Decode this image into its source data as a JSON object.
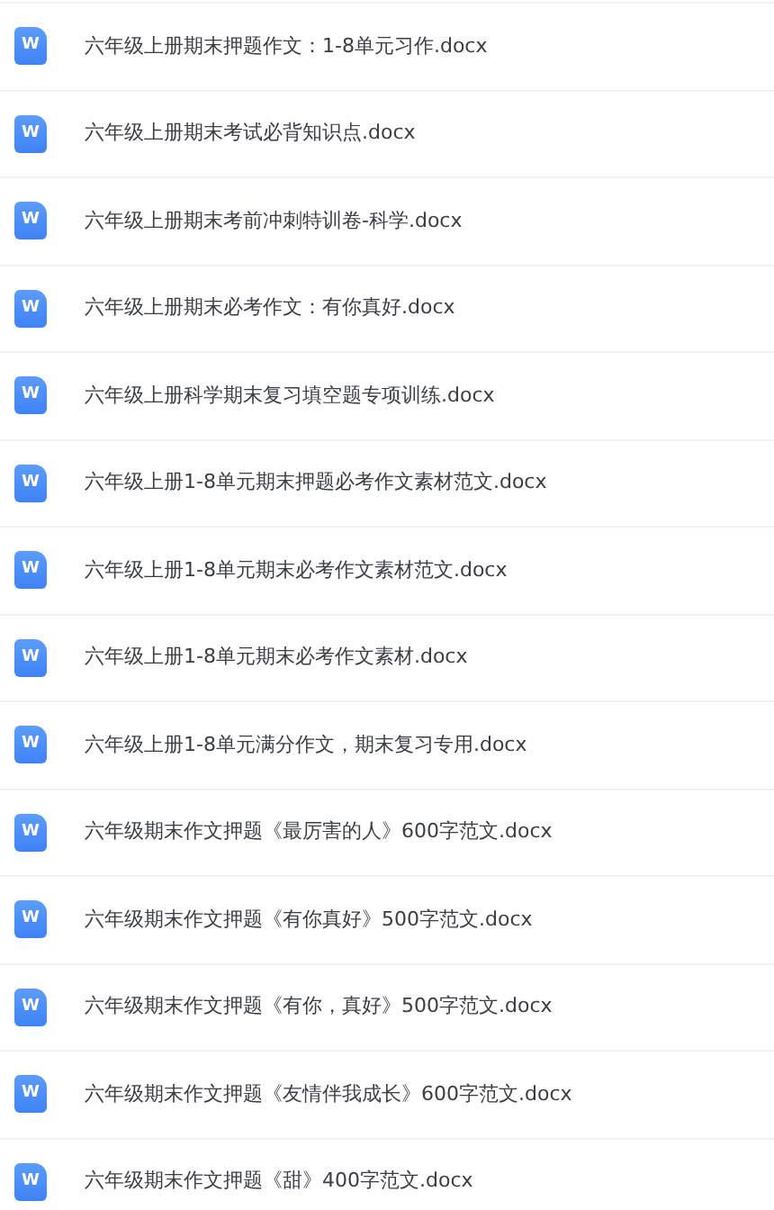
{
  "files": [
    {
      "icon_label": "W",
      "name": "六年级上册期末押题作文：1-8单元习作.docx"
    },
    {
      "icon_label": "W",
      "name": "六年级上册期末考试必背知识点.docx"
    },
    {
      "icon_label": "W",
      "name": "六年级上册期末考前冲刺特训卷-科学.docx"
    },
    {
      "icon_label": "W",
      "name": "六年级上册期末必考作文：有你真好.docx"
    },
    {
      "icon_label": "W",
      "name": "六年级上册科学期末复习填空题专项训练.docx"
    },
    {
      "icon_label": "W",
      "name": "六年级上册1-8单元期末押题必考作文素材范文.docx"
    },
    {
      "icon_label": "W",
      "name": "六年级上册1-8单元期末必考作文素材范文.docx"
    },
    {
      "icon_label": "W",
      "name": "六年级上册1-8单元期末必考作文素材.docx"
    },
    {
      "icon_label": "W",
      "name": "六年级上册1-8单元满分作文，期末复习专用.docx"
    },
    {
      "icon_label": "W",
      "name": "六年级期末作文押题《最厉害的人》600字范文.docx"
    },
    {
      "icon_label": "W",
      "name": "六年级期末作文押题《有你真好》500字范文.docx"
    },
    {
      "icon_label": "W",
      "name": "六年级期末作文押题《有你，真好》500字范文.docx"
    },
    {
      "icon_label": "W",
      "name": "六年级期末作文押题《友情伴我成长》600字范文.docx"
    },
    {
      "icon_label": "W",
      "name": "六年级期末作文押题《甜》400字范文.docx"
    }
  ]
}
